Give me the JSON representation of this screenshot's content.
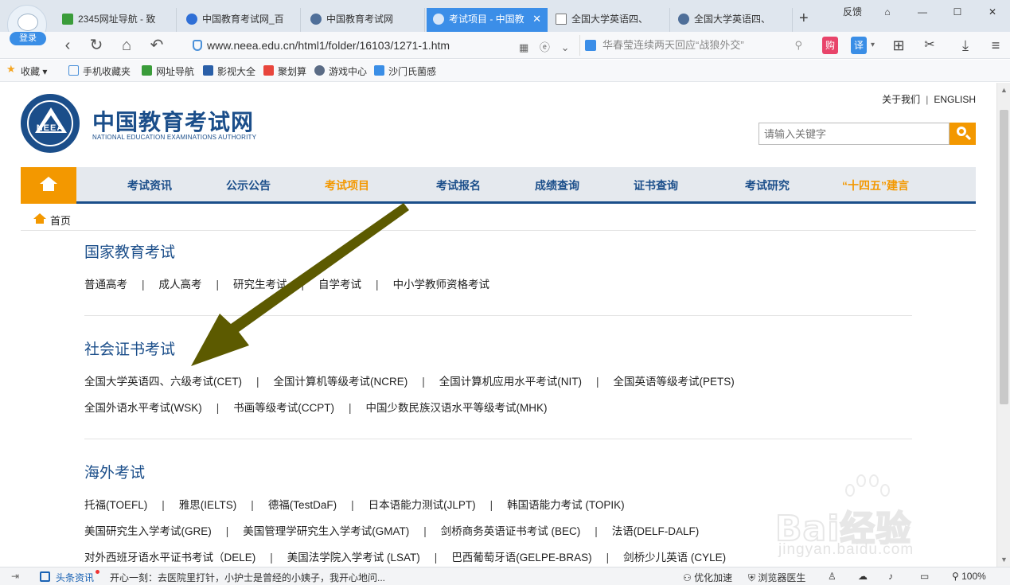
{
  "browser": {
    "login_label": "登录",
    "tabs": [
      {
        "label": "2345网址导航 - 致"
      },
      {
        "label": "中国教育考试网_百"
      },
      {
        "label": "中国教育考试网"
      },
      {
        "label": "考试项目 - 中国教",
        "active": true
      },
      {
        "label": "全国大学英语四、"
      },
      {
        "label": "全国大学英语四、"
      }
    ],
    "new_tab": "+",
    "feedback": "反馈",
    "url": "www.neea.edu.cn/html1/folder/16103/1271-1.htm",
    "news_ticker": "华春莹连续两天回应“战狼外交”",
    "shop_label": "购",
    "translate_label": "译",
    "bookmarks": [
      "收藏",
      "手机收藏夹",
      "网址导航",
      "影视大全",
      "聚划算",
      "游戏中心",
      "沙门氏菌感"
    ]
  },
  "site": {
    "top_links": {
      "about": "关于我们",
      "separator": "|",
      "english": "ENGLISH"
    },
    "logo": {
      "emblem_text": "NEEA",
      "name_cn": "中国教育考试网",
      "name_en": "NATIONAL EDUCATION EXAMINATIONS AUTHORITY"
    },
    "search": {
      "placeholder": "请输入关键字"
    },
    "nav": [
      "考试资讯",
      "公示公告",
      "考试项目",
      "考试报名",
      "成绩查询",
      "证书查询",
      "考试研究",
      "“十四五”建言"
    ],
    "breadcrumb": "首页"
  },
  "sections": [
    {
      "title": "国家教育考试",
      "rows": [
        [
          "普通高考",
          "成人高考",
          "研究生考试",
          "自学考试",
          "中小学教师资格考试"
        ]
      ]
    },
    {
      "title": "社会证书考试",
      "rows": [
        [
          "全国大学英语四、六级考试(CET)",
          "全国计算机等级考试(NCRE)",
          "全国计算机应用水平考试(NIT)",
          "全国英语等级考试(PETS)"
        ],
        [
          "全国外语水平考试(WSK)",
          "书画等级考试(CCPT)",
          "中国少数民族汉语水平等级考试(MHK)"
        ]
      ]
    },
    {
      "title": "海外考试",
      "rows": [
        [
          "托福(TOEFL)",
          "雅思(IELTS)",
          "德福(TestDaF)",
          "日本语能力测试(JLPT)",
          "韩国语能力考试 (TOPIK)"
        ],
        [
          "美国研究生入学考试(GRE)",
          "美国管理学研究生入学考试(GMAT)",
          "剑桥商务英语证书考试 (BEC)",
          "法语(DELF-DALF)"
        ],
        [
          "对外西班牙语水平证书考试（DELE)",
          "美国法学院入学考试 (LSAT)",
          "巴西葡萄牙语(GELPE-BRAS)",
          "剑桥少儿英语 (CYLE)"
        ]
      ]
    }
  ],
  "annotation": {
    "arrow_color": "#5c5a00"
  },
  "watermark": {
    "text": "Bai经验",
    "url": "jingyan.baidu.com"
  },
  "statusbar": {
    "news_label": "头条资讯",
    "ticker": "开心一刻：去医院里打针，小护士是曾经的小姨子，我开心地问...",
    "optimize": "优化加速",
    "doctor": "浏览器医生",
    "zoom": "100%"
  },
  "colors": {
    "brand_blue": "#1b4e8a",
    "accent_orange": "#f39800",
    "tab_active": "#3b8ee8"
  }
}
